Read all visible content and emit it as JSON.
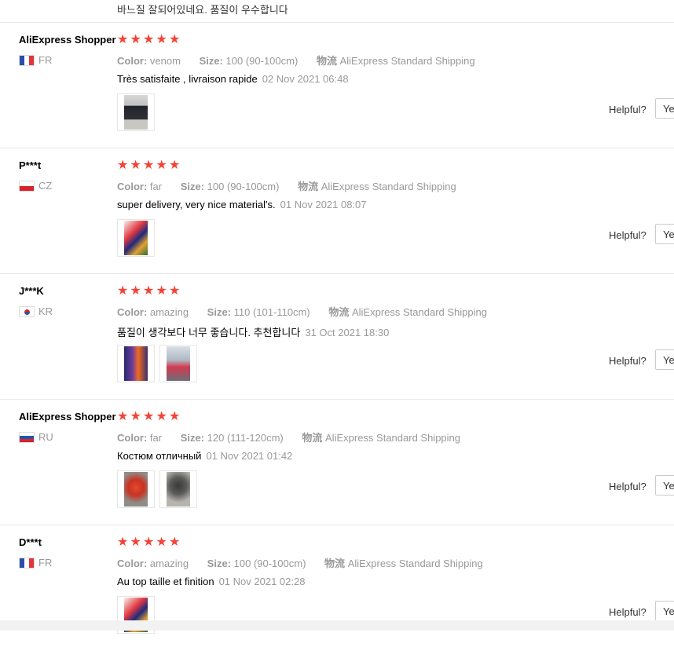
{
  "top_text": "바느질 잘되어있네요. 품질이 우수합니다",
  "labels": {
    "color": "Color:",
    "size": "Size:",
    "shipping_key": "物流",
    "helpful": "Helpful?",
    "yes": "Yes"
  },
  "reviews": [
    {
      "user": "AliExpress Shopper",
      "country": "FR",
      "flag": "fr",
      "rating": 5,
      "color": "venom",
      "size": "100 (90-100cm)",
      "shipping": "AliExpress Standard Shipping",
      "text": "Très satisfaite , livraison rapide",
      "date": "02 Nov 2021 06:48",
      "photos": [
        "photo-kid-black-costume"
      ]
    },
    {
      "user": "P***t",
      "country": "CZ",
      "flag": "cz",
      "rating": 5,
      "color": "far",
      "size": "100 (90-100cm)",
      "shipping": "AliExpress Standard Shipping",
      "text": "super delivery, very nice material's.",
      "date": "01 Nov 2021 08:07",
      "photos": [
        "photo-kid-red-costume"
      ]
    },
    {
      "user": "J***K",
      "country": "KR",
      "flag": "kr",
      "rating": 5,
      "color": "amazing",
      "size": "110 (101-110cm)",
      "shipping": "AliExpress Standard Shipping",
      "text": "품질이 생각보다 너무 좋습니다. 추천합니다",
      "date": "31 Oct 2021 18:30",
      "photos": [
        "photo-kids-costumes",
        "photo-kid-outdoor"
      ]
    },
    {
      "user": "AliExpress Shopper",
      "country": "RU",
      "flag": "ru",
      "rating": 5,
      "color": "far",
      "size": "120 (111-120cm)",
      "shipping": "AliExpress Standard Shipping",
      "text": "Костюм отличный",
      "date": "01 Nov 2021 01:42",
      "photos": [
        "photo-costume-red",
        "photo-costume-floor"
      ]
    },
    {
      "user": "D***t",
      "country": "FR",
      "flag": "fr",
      "rating": 5,
      "color": "amazing",
      "size": "100 (90-100cm)",
      "shipping": "AliExpress Standard Shipping",
      "text": "Au top taille et finition",
      "date": "01 Nov 2021 02:28",
      "photos": [
        "photo-kid-red-costume"
      ]
    }
  ],
  "colors": {
    "star": "#f44336",
    "muted_text": "#999999",
    "separator": "#e8e8e8"
  }
}
